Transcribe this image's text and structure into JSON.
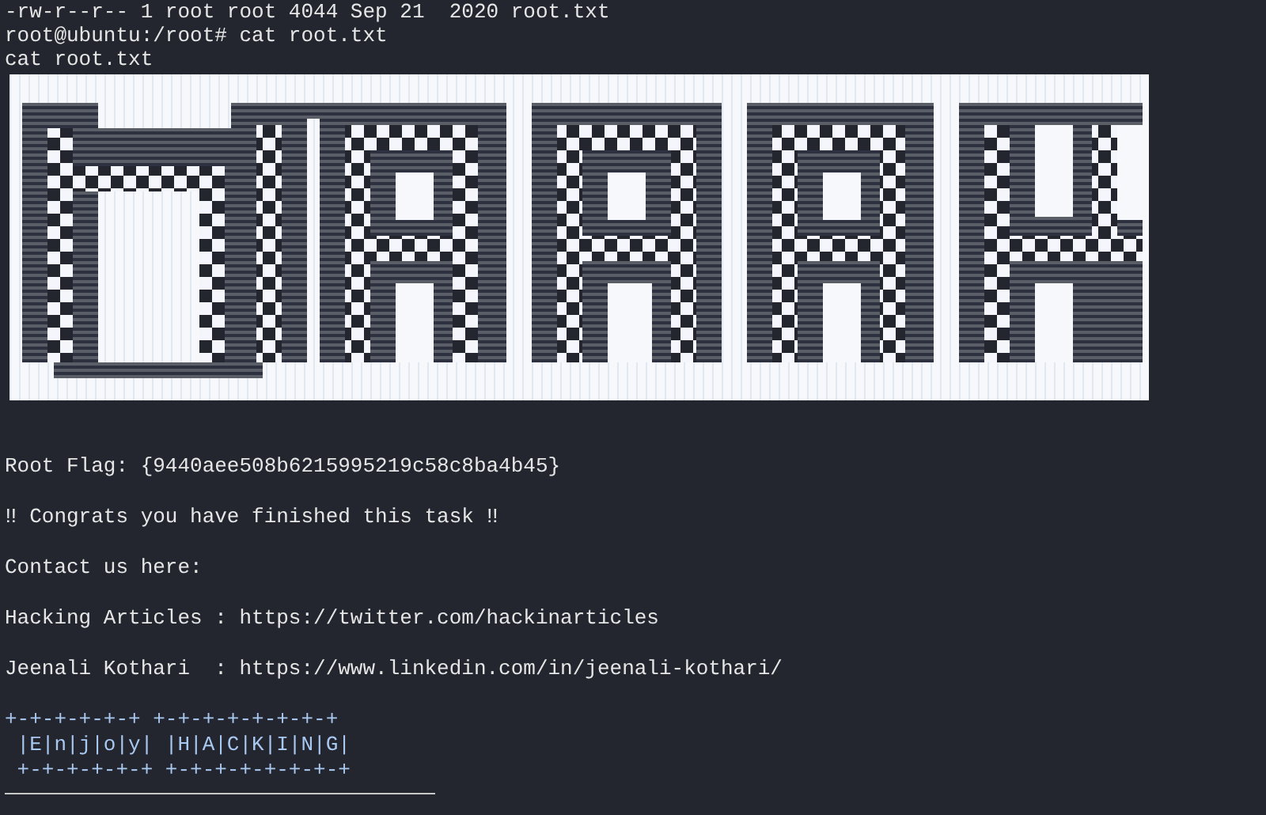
{
  "terminal": {
    "head": [
      "-rw-r--r-- 1 root root 4044 Sep 21  2020 root.txt",
      "root@ubuntu:/root# cat root.txt",
      "cat root.txt"
    ],
    "body": [
      {
        "kind": "para",
        "text": "Root Flag: {9440aee508b6215995219c58c8ba4b45}"
      },
      {
        "kind": "para",
        "text": "‼ Congrats you have finished this task ‼"
      },
      {
        "kind": "para",
        "text": "Contact us here:"
      },
      {
        "kind": "para",
        "text": "Hacking Articles : https://twitter.com/hackinarticles"
      },
      {
        "kind": "para",
        "text": "Jeenali Kothari  : https://www.linkedin.com/in/jeenali-kothari/"
      },
      {
        "kind": "para_art",
        "text": "+-+-+-+-+-+ +-+-+-+-+-+-+-+"
      },
      {
        "kind": "art",
        "text": " |E|n|j|o|y| |H|A|C|K|I|N|G|"
      },
      {
        "kind": "art",
        "text": " +-+-+-+-+-+ +-+-+-+-+-+-+-+"
      }
    ]
  }
}
